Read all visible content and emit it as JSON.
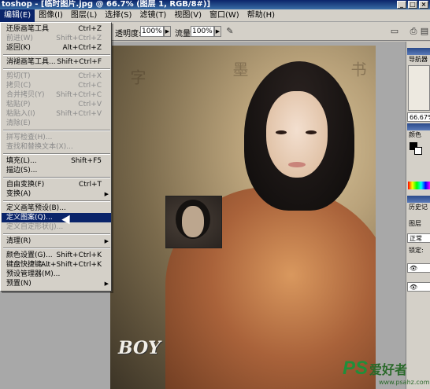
{
  "title_bar": {
    "title": "toshop - [临时图片.jpg @ 66.7% (图层 1, RGB/8#)]",
    "buttons": [
      "_",
      "□",
      "×"
    ]
  },
  "menu_bar": {
    "items": [
      "编辑(E)",
      "图像(I)",
      "图层(L)",
      "选择(S)",
      "滤镜(T)",
      "视图(V)",
      "窗口(W)",
      "帮助(H)"
    ],
    "active": "编辑(E)"
  },
  "options_bar": {
    "opacity_label": "透明度:",
    "opacity_value": "100%",
    "flow_label": "流量:",
    "flow_value": "100%"
  },
  "edit_menu": [
    {
      "label": "还原画笔工具",
      "shortcut": "Ctrl+Z",
      "state": "normal"
    },
    {
      "label": "前进(W)",
      "shortcut": "Shift+Ctrl+Z",
      "state": "disabled"
    },
    {
      "label": "返回(K)",
      "shortcut": "Alt+Ctrl+Z",
      "state": "normal"
    },
    {
      "sep": true
    },
    {
      "label": "消褪画笔工具...",
      "shortcut": "Shift+Ctrl+F",
      "state": "normal"
    },
    {
      "sep": true
    },
    {
      "label": "剪切(T)",
      "shortcut": "Ctrl+X",
      "state": "disabled"
    },
    {
      "label": "拷贝(C)",
      "shortcut": "Ctrl+C",
      "state": "disabled"
    },
    {
      "label": "合并拷贝(Y)",
      "shortcut": "Shift+Ctrl+C",
      "state": "disabled"
    },
    {
      "label": "粘贴(P)",
      "shortcut": "Ctrl+V",
      "state": "disabled"
    },
    {
      "label": "粘贴入(I)",
      "shortcut": "Shift+Ctrl+V",
      "state": "disabled"
    },
    {
      "label": "清除(E)",
      "shortcut": "",
      "state": "disabled"
    },
    {
      "sep": true
    },
    {
      "label": "拼写检查(H)...",
      "shortcut": "",
      "state": "disabled"
    },
    {
      "label": "查找和替换文本(X)...",
      "shortcut": "",
      "state": "disabled"
    },
    {
      "sep": true
    },
    {
      "label": "填充(L)...",
      "shortcut": "Shift+F5",
      "state": "normal"
    },
    {
      "label": "描边(S)...",
      "shortcut": "",
      "state": "normal"
    },
    {
      "sep": true
    },
    {
      "label": "自由变换(F)",
      "shortcut": "Ctrl+T",
      "state": "normal"
    },
    {
      "label": "变换(A)",
      "shortcut": "",
      "state": "normal",
      "submenu": true
    },
    {
      "sep": true
    },
    {
      "label": "定义画笔预设(B)...",
      "shortcut": "",
      "state": "normal"
    },
    {
      "label": "定义图案(Q)...",
      "shortcut": "",
      "state": "selected"
    },
    {
      "label": "定义自定形状(J)...",
      "shortcut": "",
      "state": "disabled"
    },
    {
      "sep": true
    },
    {
      "label": "清理(R)",
      "shortcut": "",
      "state": "normal",
      "submenu": true
    },
    {
      "sep": true
    },
    {
      "label": "颜色设置(G)...",
      "shortcut": "Shift+Ctrl+K",
      "state": "normal"
    },
    {
      "label": "键盘快捷键...",
      "shortcut": "Alt+Shift+Ctrl+K",
      "state": "normal"
    },
    {
      "label": "预设管理器(M)...",
      "shortcut": "",
      "state": "normal"
    },
    {
      "label": "预置(N)",
      "shortcut": "",
      "state": "normal",
      "submenu": true
    }
  ],
  "canvas": {
    "watermark": "BOY"
  },
  "right_panel": {
    "navigator_tab": "导航器",
    "zoom_value": "66.67%",
    "color_tab": "颜色",
    "history_tab": "历史记",
    "layers_tab": "图层",
    "blend_mode": "正常",
    "lock_label": "锁定:"
  },
  "site_logo": {
    "ps": "PS",
    "cn": "爱好者",
    "url": "www.psahz.com"
  }
}
